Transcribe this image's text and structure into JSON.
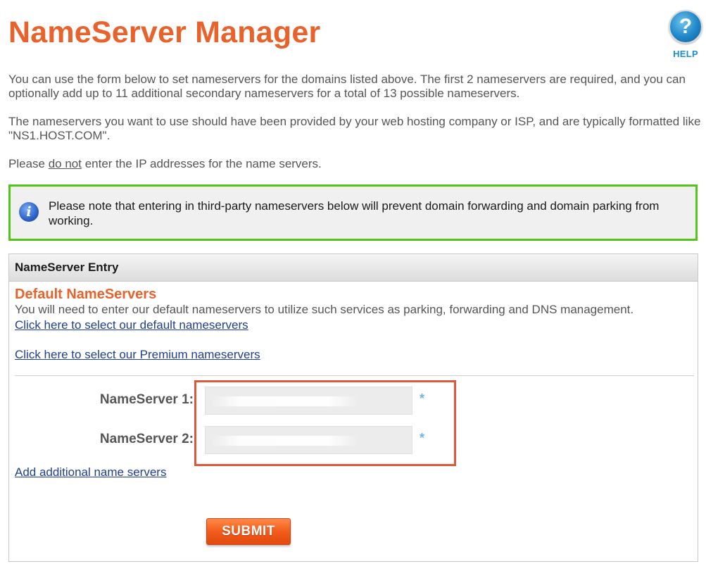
{
  "page": {
    "title": "NameServer Manager",
    "help_label": "HELP",
    "help_glyph": "?",
    "intro_paragraph": "You can use the form below to set nameservers for the domains listed above. The first 2 nameservers are required, and you can optionally add up to 11 additional secondary nameservers for a total of 13 possible nameservers.",
    "format_paragraph": "The nameservers you want to use should have been provided by your web hosting company or ISP, and are typically formatted like \"NS1.HOST.COM\".",
    "ip_warning": {
      "before": "Please ",
      "emphasis": "do not",
      "after": " enter the IP addresses for the name servers."
    }
  },
  "notice": {
    "icon": "info-icon",
    "icon_glyph": "i",
    "text": "Please note that entering in third-party nameservers below will prevent domain forwarding and domain parking from working.",
    "border_color": "#52c41a"
  },
  "panel": {
    "header": "NameServer Entry",
    "section_title": "Default NameServers",
    "section_description": "You will need to enter our default nameservers to utilize such services as parking, forwarding and DNS management.",
    "default_link": "Click here to select our default nameservers",
    "premium_link": "Click here to select our Premium nameservers",
    "fields": [
      {
        "label": "NameServer 1:",
        "value": "",
        "required_mark": "*"
      },
      {
        "label": "NameServer 2:",
        "value": "",
        "required_mark": "*"
      }
    ],
    "add_link": "Add additional name servers",
    "submit_label": "SUBMIT"
  },
  "colors": {
    "accent": "#e9622b",
    "link": "#1f3f8f",
    "highlight_border": "#e0583a",
    "notice_border": "#52c41a"
  }
}
